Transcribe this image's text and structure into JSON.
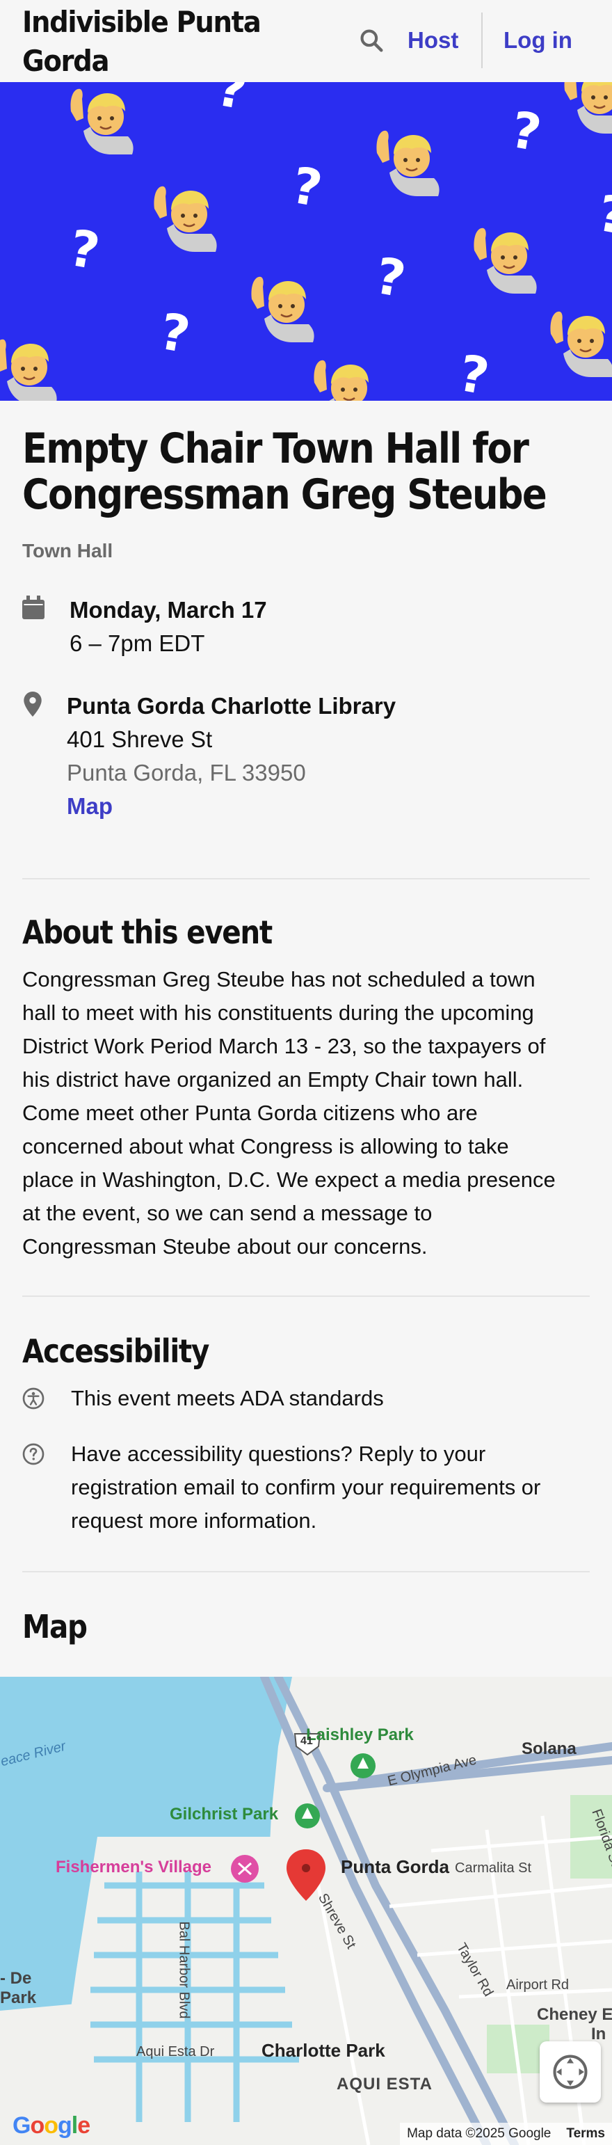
{
  "header": {
    "org_name": "Indivisible Punta Gorda",
    "host_label": "Host",
    "login_label": "Log in"
  },
  "event": {
    "title": "Empty Chair Town Hall for Congressman Greg Steube",
    "type": "Town Hall",
    "date": "Monday, March 17",
    "time": "6 – 7pm EDT",
    "venue": {
      "name": "Punta Gorda Charlotte Library",
      "street": "401 Shreve St",
      "city": "Punta Gorda, FL 33950",
      "map_link": "Map"
    }
  },
  "about": {
    "title": "About this event",
    "lines": [
      "Congressman Greg Steube has not scheduled a town",
      "hall to meet with his constituents during the upcoming",
      "District Work Period March 13 - 23, so the taxpayers of",
      "his district have organized an Empty Chair town hall.",
      "Come meet other Punta Gorda citizens who are",
      "concerned about what Congress is allowing to take",
      "place in Washington, D.C. We expect a media presence",
      "at the event, so we can send a message to",
      "Congressman Steube about our concerns."
    ]
  },
  "accessibility": {
    "title": "Accessibility",
    "ada": "This event meets ADA standards",
    "question_lines": [
      "Have accessibility questions? Reply to your",
      "registration email to confirm your requirements or",
      "request more information."
    ]
  },
  "map_section": {
    "title": "Map",
    "labels": {
      "laishley": "Laishley Park",
      "solana": "Solana",
      "olympia": "E Olympia Ave",
      "gilchrist": "Gilchrist Park",
      "fishermen": "Fishermen's Village",
      "punta_gorda": "Punta Gorda",
      "carmalita": "Carmalita St",
      "shreve": "Shreve St",
      "bal_harbor": "Bal Harbor Blvd",
      "taylor": "Taylor Rd",
      "airport": "Airport Rd",
      "cheney": "Cheney E",
      "cheney2": "In",
      "aqui_esta_dr": "Aqui Esta Dr",
      "charlotte_park": "Charlotte Park",
      "aqui_esta": "AQUI ESTA",
      "peace_river": "eace River",
      "de_park": "- De",
      "park": "Park",
      "florida": "Florida St",
      "route": "41"
    },
    "attribution": "Map data ©2025 Google",
    "terms": "Terms",
    "logo": "Google"
  },
  "colors": {
    "accent": "#3d3dc6",
    "banner": "#2a2df0",
    "water": "#8fd1ea",
    "land": "#f1f1ee",
    "park": "#cdebc9",
    "pin": "#e53935"
  },
  "icons": [
    "search-icon",
    "calendar-icon",
    "location-pin-icon",
    "accessibility-icon",
    "question-icon",
    "map-pin-icon",
    "tree-icon",
    "fullscreen-icon"
  ]
}
